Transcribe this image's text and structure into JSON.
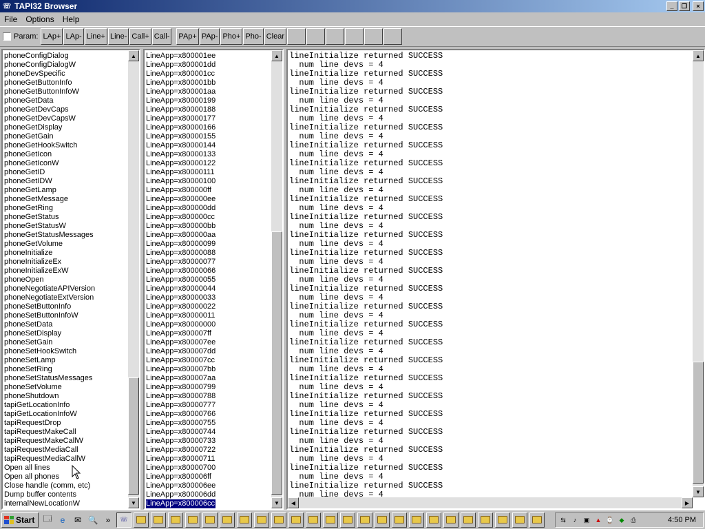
{
  "window": {
    "title": "TAPI32 Browser",
    "minimize": "_",
    "restore": "❐",
    "close": "×"
  },
  "menu": [
    "File",
    "Options",
    "Help"
  ],
  "toolbar": {
    "param_label": "Param:",
    "param_checked": false,
    "buttons": [
      "LAp+",
      "LAp-",
      "Line+",
      "Line-",
      "Call+",
      "Call-"
    ],
    "buttons2": [
      "PAp+",
      "PAp-",
      "Pho+",
      "Pho-"
    ],
    "clear": "Clear",
    "blank_count": 6
  },
  "functions": {
    "items": [
      "phoneConfigDialog",
      "phoneConfigDialogW",
      "phoneDevSpecific",
      "phoneGetButtonInfo",
      "phoneGetButtonInfoW",
      "phoneGetData",
      "phoneGetDevCaps",
      "phoneGetDevCapsW",
      "phoneGetDisplay",
      "phoneGetGain",
      "phoneGetHookSwitch",
      "phoneGetIcon",
      "phoneGetIconW",
      "phoneGetID",
      "phoneGetIDW",
      "phoneGetLamp",
      "phoneGetMessage",
      "phoneGetRing",
      "phoneGetStatus",
      "phoneGetStatusW",
      "phoneGetStatusMessages",
      "phoneGetVolume",
      "phoneInitialize",
      "phoneInitializeEx",
      "phoneInitializeExW",
      "phoneOpen",
      "phoneNegotiateAPIVersion",
      "phoneNegotiateExtVersion",
      "phoneSetButtonInfo",
      "phoneSetButtonInfoW",
      "phoneSetData",
      "phoneSetDisplay",
      "phoneSetGain",
      "phoneSetHookSwitch",
      "phoneSetLamp",
      "phoneSetRing",
      "phoneSetStatusMessages",
      "phoneSetVolume",
      "phoneShutdown",
      "tapiGetLocationInfo",
      "tapiGetLocationInfoW",
      "tapiRequestDrop",
      "tapiRequestMakeCall",
      "tapiRequestMakeCallW",
      "tapiRequestMediaCall",
      "tapiRequestMediaCallW",
      "Open all lines",
      "Open all phones",
      "Close handle (comm, etc)",
      "Dump buffer contents",
      "internalNewLocationW"
    ]
  },
  "handles": {
    "selected_index": 50,
    "items": [
      "LineApp=x800001ee",
      "LineApp=x800001dd",
      "LineApp=x800001cc",
      "LineApp=x800001bb",
      "LineApp=x800001aa",
      "LineApp=x80000199",
      "LineApp=x80000188",
      "LineApp=x80000177",
      "LineApp=x80000166",
      "LineApp=x80000155",
      "LineApp=x80000144",
      "LineApp=x80000133",
      "LineApp=x80000122",
      "LineApp=x80000111",
      "LineApp=x80000100",
      "LineApp=x800000ff",
      "LineApp=x800000ee",
      "LineApp=x800000dd",
      "LineApp=x800000cc",
      "LineApp=x800000bb",
      "LineApp=x800000aa",
      "LineApp=x80000099",
      "LineApp=x80000088",
      "LineApp=x80000077",
      "LineApp=x80000066",
      "LineApp=x80000055",
      "LineApp=x80000044",
      "LineApp=x80000033",
      "LineApp=x80000022",
      "LineApp=x80000011",
      "LineApp=x80000000",
      "LineApp=x800007ff",
      "LineApp=x800007ee",
      "LineApp=x800007dd",
      "LineApp=x800007cc",
      "LineApp=x800007bb",
      "LineApp=x800007aa",
      "LineApp=x80000799",
      "LineApp=x80000788",
      "LineApp=x80000777",
      "LineApp=x80000766",
      "LineApp=x80000755",
      "LineApp=x80000744",
      "LineApp=x80000733",
      "LineApp=x80000722",
      "LineApp=x80000711",
      "LineApp=x80000700",
      "LineApp=x800006ff",
      "LineApp=x800006ee",
      "LineApp=x800006dd",
      "LineApp=x800006cc"
    ]
  },
  "log": {
    "lines": [
      "lineInitialize returned SUCCESS",
      "  num line devs = 4",
      "lineInitialize returned SUCCESS",
      "  num line devs = 4",
      "lineInitialize returned SUCCESS",
      "  num line devs = 4",
      "lineInitialize returned SUCCESS",
      "  num line devs = 4",
      "lineInitialize returned SUCCESS",
      "  num line devs = 4",
      "lineInitialize returned SUCCESS",
      "  num line devs = 4",
      "lineInitialize returned SUCCESS",
      "  num line devs = 4",
      "lineInitialize returned SUCCESS",
      "  num line devs = 4",
      "lineInitialize returned SUCCESS",
      "  num line devs = 4",
      "lineInitialize returned SUCCESS",
      "  num line devs = 4",
      "lineInitialize returned SUCCESS",
      "  num line devs = 4",
      "lineInitialize returned SUCCESS",
      "  num line devs = 4",
      "lineInitialize returned SUCCESS",
      "  num line devs = 4",
      "lineInitialize returned SUCCESS",
      "  num line devs = 4",
      "lineInitialize returned SUCCESS",
      "  num line devs = 4",
      "lineInitialize returned SUCCESS",
      "  num line devs = 4",
      "lineInitialize returned SUCCESS",
      "  num line devs = 4",
      "lineInitialize returned SUCCESS",
      "  num line devs = 4",
      "lineInitialize returned SUCCESS",
      "  num line devs = 4",
      "lineInitialize returned SUCCESS",
      "  num line devs = 4",
      "lineInitialize returned SUCCESS",
      "  num line devs = 4",
      "lineInitialize returned SUCCESS",
      "  num line devs = 4",
      "lineInitialize returned SUCCESS",
      "  num line devs = 4",
      "lineInitialize returned SUCCESS",
      "  num line devs = 4",
      "lineInitialize returned SUCCESS",
      "  num line devs = 4"
    ]
  },
  "taskbar": {
    "start": "Start",
    "quicklaunch_more": "»",
    "task_button_count": 24,
    "clock": "4:50 PM"
  },
  "colors": {
    "title_start": "#0a246a",
    "title_end": "#a6caf0",
    "selection": "#000080",
    "face": "#c0c0c0"
  }
}
